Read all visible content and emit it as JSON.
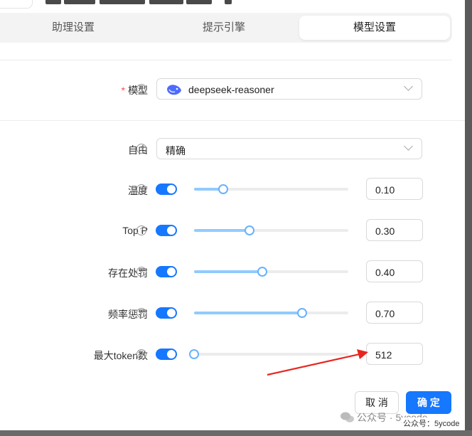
{
  "tabs": [
    {
      "label": "助理设置",
      "active": false
    },
    {
      "label": "提示引擎",
      "active": false
    },
    {
      "label": "模型设置",
      "active": true
    }
  ],
  "model": {
    "label": "模型",
    "required": true,
    "value": "deepseek-reasoner",
    "icon": "deepseek-whale-icon"
  },
  "freedom": {
    "label": "自由",
    "value": "精确"
  },
  "params": [
    {
      "label": "温度",
      "enabled": true,
      "value": "0.10",
      "fraction": 0.1
    },
    {
      "label": "Top P",
      "enabled": true,
      "value": "0.30",
      "fraction": 0.3
    },
    {
      "label": "存在处罚",
      "enabled": true,
      "value": "0.40",
      "fraction": 0.4
    },
    {
      "label": "频率惩罚",
      "enabled": true,
      "value": "0.70",
      "fraction": 0.7
    },
    {
      "label": "最大token数",
      "enabled": true,
      "value": "512",
      "fraction": 0.0
    }
  ],
  "buttons": {
    "cancel": "取 消",
    "ok": "确 定"
  },
  "watermark": {
    "overlay": "公众号 · 5ycode",
    "bottom": "公众号：5ycode"
  },
  "colors": {
    "accent": "#1677ff",
    "arrow": "#e8251f",
    "required": "#ff4d4f"
  }
}
